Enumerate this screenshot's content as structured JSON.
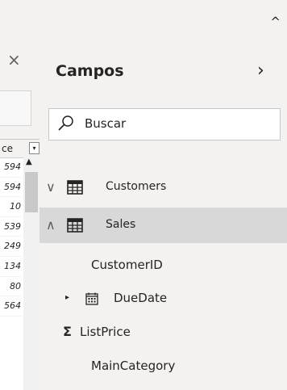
{
  "filters_pane": {
    "close_glyph": "×"
  },
  "table": {
    "column_header": "ce",
    "filter_glyph": "▾",
    "scroll_up_glyph": "▲",
    "rows": [
      "594",
      "594",
      "10",
      "539",
      "249",
      "134",
      "80",
      "564"
    ]
  },
  "top": {
    "collapse_glyph": "^"
  },
  "fields": {
    "title": "Campos",
    "expand_glyph": "›",
    "search_placeholder": "Buscar",
    "tables": [
      {
        "name": "Customers",
        "chevron": "∨",
        "selected": false
      },
      {
        "name": "Sales",
        "chevron": "∧",
        "selected": true
      }
    ],
    "sales_fields": [
      {
        "name": "CustomerID",
        "icon": "none"
      },
      {
        "name": "DueDate",
        "icon": "calendar-icon",
        "caret": "▸"
      },
      {
        "name": "ListPrice",
        "icon": "sigma-icon",
        "glyph": "Σ"
      },
      {
        "name": "MainCategory",
        "icon": "none"
      }
    ]
  }
}
